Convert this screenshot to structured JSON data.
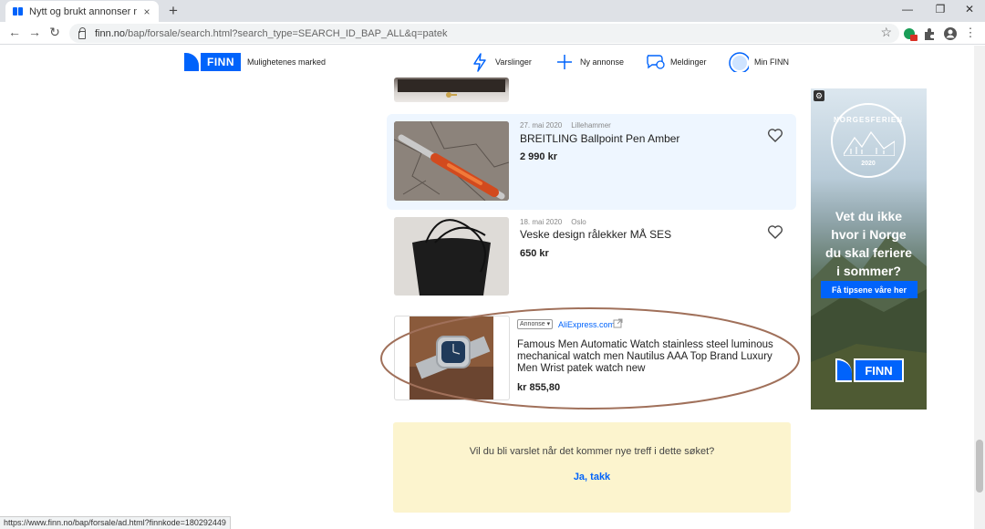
{
  "browser": {
    "tab_title": "Nytt og brukt annonser med søk",
    "tab_close": "×",
    "new_tab": "+",
    "url_host": "finn.no",
    "url_path": "/bap/forsale/search.html?search_type=SEARCH_ID_BAP_ALL&q=patek",
    "back": "←",
    "forward": "→",
    "reload": "↻",
    "bookmark_star": "☆",
    "win_min": "—",
    "win_max": "❐",
    "win_close": "✕",
    "menu_dots": "⋮",
    "status_url": "https://www.finn.no/bap/forsale/ad.html?finnkode=180292449"
  },
  "header": {
    "logo_text": "FINN",
    "tagline": "Mulighetenes marked",
    "nav": [
      {
        "label": "Varslinger",
        "icon": "bolt-icon"
      },
      {
        "label": "Ny annonse",
        "icon": "plus-icon"
      },
      {
        "label": "Meldinger",
        "icon": "chat-icon"
      },
      {
        "label": "Min FINN",
        "icon": "avatar-icon"
      }
    ]
  },
  "results": [
    {
      "date": "27. mai 2020",
      "location": "Lillehammer",
      "title": "BREITLING Ballpoint Pen Amber",
      "price": "2 990 kr",
      "highlighted": true
    },
    {
      "date": "18. mai 2020",
      "location": "Oslo",
      "title": "Veske design rålekker MÅ SES",
      "price": "650 kr",
      "highlighted": false
    }
  ],
  "sponsored": {
    "badge": "Annonse ▾",
    "source": "AliExpress.com",
    "title": "Famous Men Automatic Watch stainless steel luminous mechanical watch men Nautilus AAA Top Brand Luxury Men Wrist patek watch new",
    "price": "kr 855,80"
  },
  "alert": {
    "question": "Vil du bli varslet når det kommer nye treff i dette søket?",
    "button": "Ja, takk"
  },
  "side_ad": {
    "badge_top": "NORGESFERIEN",
    "badge_year": "2020",
    "headline_lines": [
      "Vet du ikke",
      "hvor i Norge",
      "du skal feriere",
      "i sommer?"
    ],
    "cta": "Få tipsene våre her",
    "logo": "FINN"
  },
  "colors": {
    "brand_blue": "#0063fb",
    "highlight_bg": "#eef6ff",
    "alert_bg": "#fcf4ce",
    "annotation_ring": "#a0705a"
  }
}
